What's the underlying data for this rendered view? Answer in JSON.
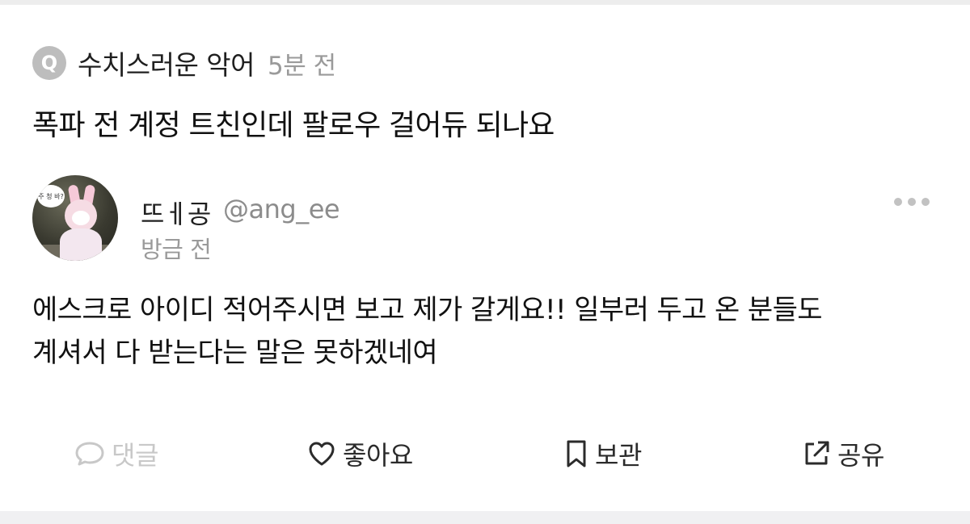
{
  "question": {
    "badge_letter": "Q",
    "author": "수치스러운 악어",
    "time": "5분 전",
    "title": "폭파 전 계정 트친인데 팔로우 걸어듀 되나요"
  },
  "comment": {
    "avatar_bubble_text": "주 청 바?",
    "author_name": "뜨ㅔ공",
    "author_handle": "@ang_ee",
    "time": "방금 전",
    "body_lines": [
      "에스크로 아이디 적어주시면 보고 제가 갈게요!! 일부러 두고 온 분들도",
      "계셔서 다 받는다는 말은 못하겠네여"
    ]
  },
  "actions": {
    "reply_label": "댓글",
    "like_label": "좋아요",
    "save_label": "보관",
    "share_label": "공유"
  },
  "icons": {
    "question": "q-badge-icon",
    "more": "more-dots-icon",
    "reply": "speech-bubble-icon",
    "like": "heart-icon",
    "save": "bookmark-icon",
    "share": "share-external-icon"
  },
  "colors": {
    "text_primary": "#111111",
    "text_secondary": "#9a9a9a",
    "disabled": "#c8c8c8",
    "badge_bg": "#bdbdbd"
  }
}
